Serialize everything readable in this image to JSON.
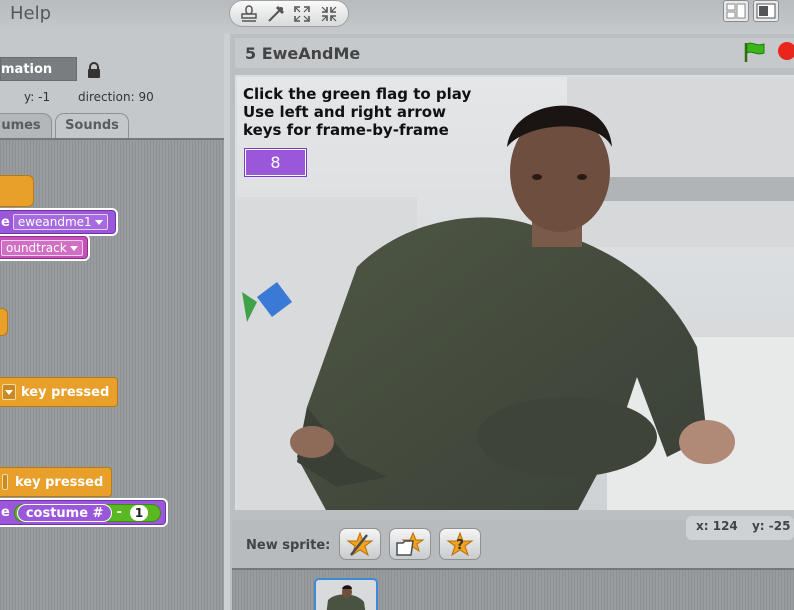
{
  "menu": {
    "help": "Help"
  },
  "toolbar": {
    "icons": [
      "stamp-icon",
      "scissors-icon",
      "grow-icon",
      "shrink-icon"
    ]
  },
  "sprite": {
    "name_partial": "mation",
    "y_label": "y:",
    "y_value": "-1",
    "direction_label": "direction:",
    "direction_value": "90"
  },
  "tabs": {
    "costumes": "umes",
    "sounds": "Sounds"
  },
  "blocks": {
    "switch_to_costume": {
      "prefix": "e",
      "dropdown": "eweandme1"
    },
    "play_sound": {
      "dropdown": "oundtrack"
    },
    "key_pressed_1": "key pressed",
    "key_pressed_2": "key pressed",
    "switch_costume_expr": {
      "prefix": "e",
      "reporter": "costume #",
      "op": "-",
      "number": "1"
    }
  },
  "stage": {
    "title": "5 EweAndMe",
    "instructions": [
      "Click the green flag to play",
      "Use left and right arrow",
      "keys for frame-by-frame"
    ],
    "frame_monitor": "8"
  },
  "coords": {
    "x_label": "x:",
    "x_value": "124",
    "y_label": "y:",
    "y_value": "-25"
  },
  "new_sprite": {
    "label": "New sprite:"
  },
  "colors": {
    "accent_purple": "#9b57d9",
    "control_yellow": "#e9a02a",
    "sound_magenta": "#c64fb8",
    "operator_green": "#5ab820",
    "stop_red": "#e8261b"
  }
}
